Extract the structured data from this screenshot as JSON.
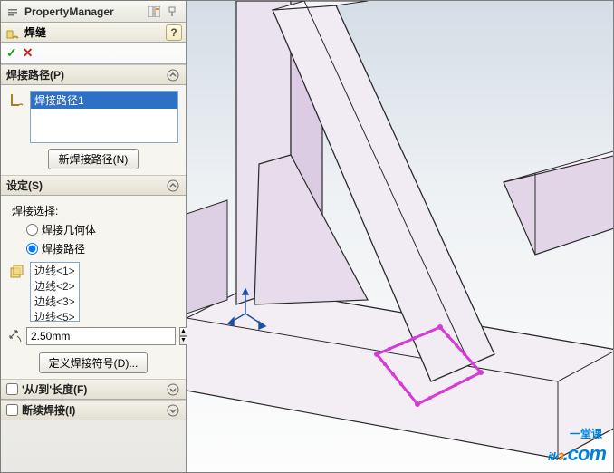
{
  "header": {
    "title": "PropertyManager"
  },
  "feature": {
    "title": "焊缝"
  },
  "confirm": {
    "ok": "✓",
    "cancel": "✕"
  },
  "sections": {
    "weld_path": {
      "title": "焊接路径(P)",
      "items": [
        "焊接路径1"
      ],
      "new_button": "新焊接路径(N)"
    },
    "settings": {
      "title": "设定(S)",
      "selection_label": "焊接选择:",
      "radio_geom": "焊接几何体",
      "radio_path": "焊接路径",
      "radio_selected": "path",
      "edges": [
        "边线<1>",
        "边线<2>",
        "边线<3>",
        "边线<5>"
      ],
      "dimension": "2.50mm",
      "symbol_button": "定义焊接符号(D)..."
    },
    "from_to": {
      "title": "'从/到'长度(F)",
      "checked": false
    },
    "intermittent": {
      "title": "断续焊接(I)",
      "checked": false
    }
  },
  "watermark": {
    "main_a": "itk",
    "main_b": "3",
    "main_c": ".com",
    "sub": "一堂课"
  }
}
